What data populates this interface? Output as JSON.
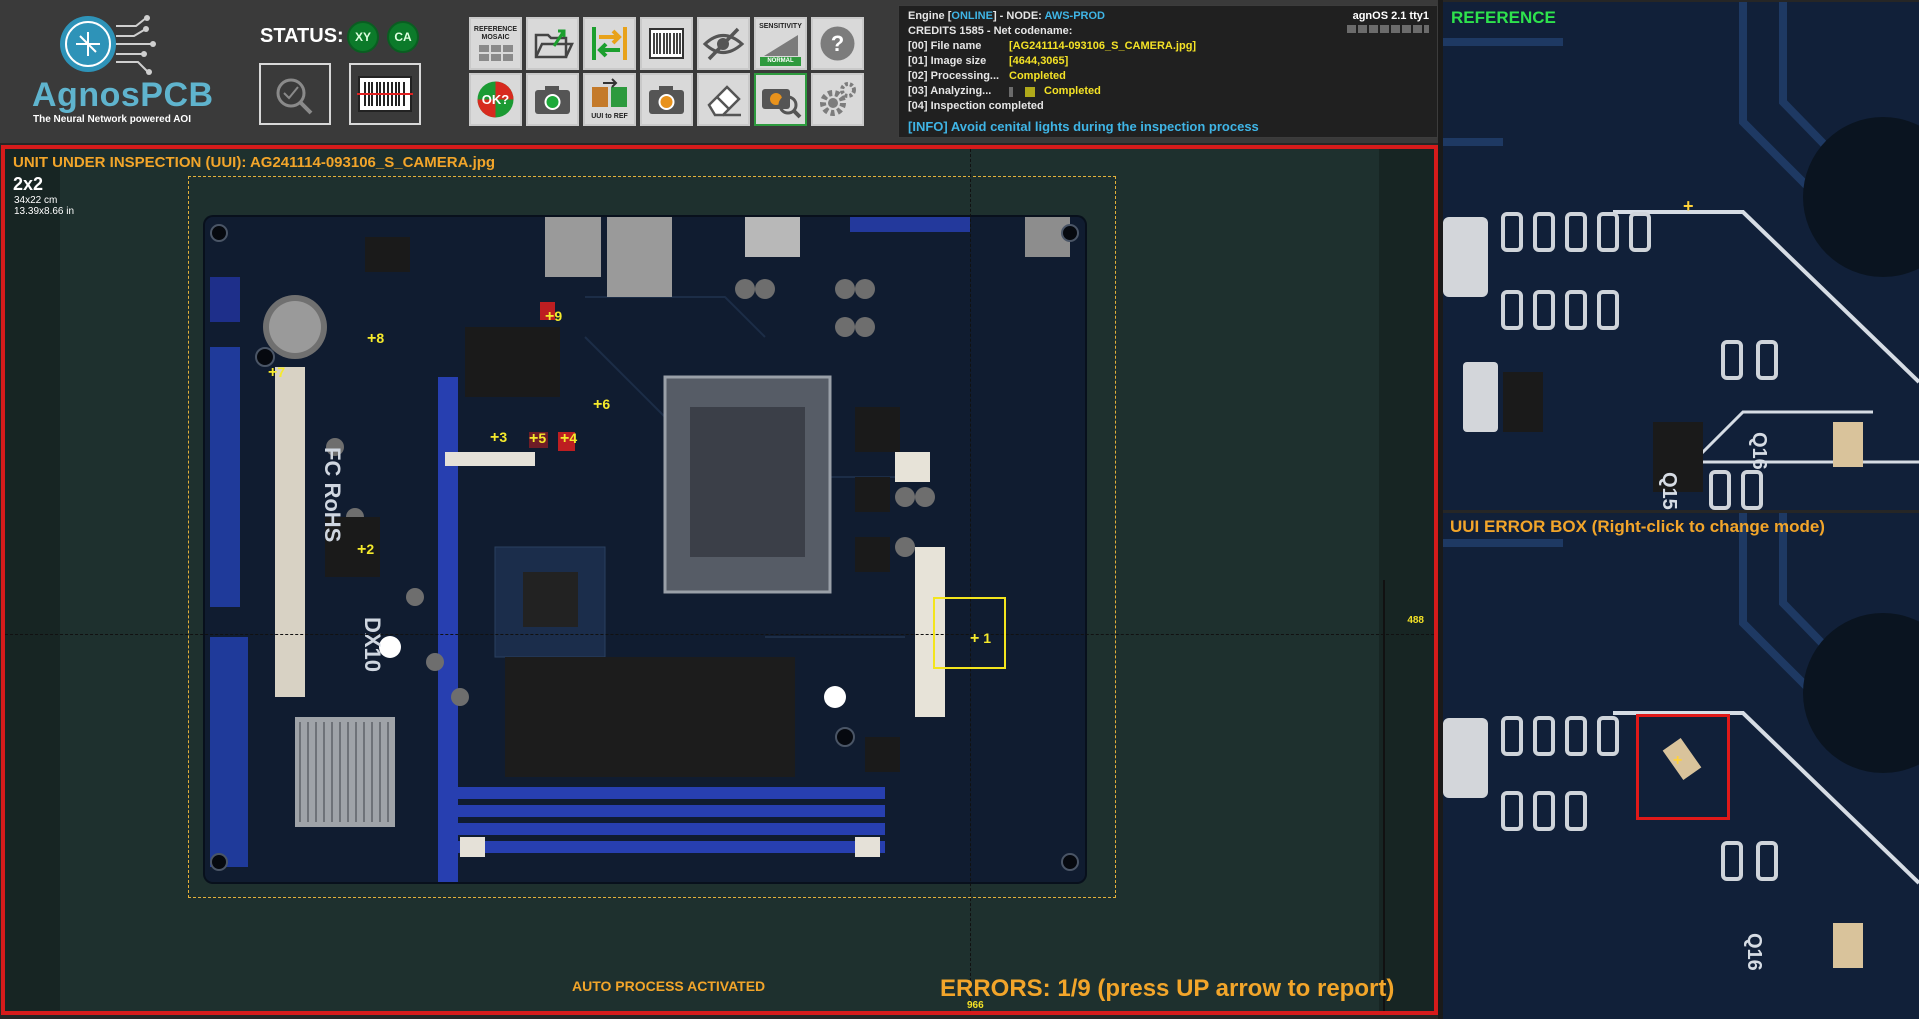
{
  "app": {
    "name": "AgnosPCB",
    "tagline": "The Neural Network powered AOI"
  },
  "status": {
    "label": "STATUS:",
    "indicators": [
      "XY",
      "CA"
    ]
  },
  "toolbar": {
    "row1": [
      {
        "name": "reference-mosaic",
        "caption": "REFERENCE MOSAIC"
      },
      {
        "name": "open-folder",
        "caption": ""
      },
      {
        "name": "swap",
        "caption": ""
      },
      {
        "name": "barcode",
        "caption": ""
      },
      {
        "name": "hide",
        "caption": ""
      },
      {
        "name": "sensitivity",
        "caption": "SENSITIVITY",
        "level": "NORMAL"
      },
      {
        "name": "help",
        "caption": ""
      }
    ],
    "row2": [
      {
        "name": "ok-check",
        "caption": "OK?"
      },
      {
        "name": "camera-green",
        "caption": ""
      },
      {
        "name": "uui-to-ref",
        "caption": "UUI to REF"
      },
      {
        "name": "camera-orange",
        "caption": ""
      },
      {
        "name": "eraser",
        "caption": ""
      },
      {
        "name": "camera-search",
        "caption": ""
      },
      {
        "name": "settings",
        "caption": ""
      }
    ]
  },
  "console": {
    "engine_prefix": "Engine [",
    "engine_state": "ONLINE",
    "engine_mid": "] - NODE: ",
    "node": "AWS-PROD",
    "credits": "CREDITS 1585 - Net codename:",
    "os": "agnOS 2.1 tty1",
    "lines": [
      {
        "label": "[00] File name",
        "value": "[AG241114-093106_S_CAMERA.jpg]"
      },
      {
        "label": "[01] Image size",
        "value": "[4644,3065]"
      },
      {
        "label": "[02] Processing...",
        "value": "Completed"
      },
      {
        "label": "[03] Analyzing...",
        "value": "Completed"
      },
      {
        "label": "[04] Inspection completed",
        "value": ""
      }
    ],
    "info": "[INFO] Avoid cenital lights during the inspection process"
  },
  "uui": {
    "title": "UNIT UNDER INSPECTION (UUI): AG241114-093106_S_CAMERA.jpg",
    "grid": "2x2",
    "size_cm": "34x22 cm",
    "size_in": "13.39x8.66 in",
    "coord_h": "488",
    "coord_v": "966",
    "auto_process": "AUTO PROCESS ACTIVATED",
    "errors": "ERRORS: 1/9 (press UP arrow to report)",
    "markers": [
      "1",
      "2",
      "3",
      "4",
      "5",
      "6",
      "7",
      "8",
      "9"
    ]
  },
  "reference": {
    "title": "REFERENCE"
  },
  "error_box": {
    "title": "UUI ERROR BOX (Right-click to change mode)"
  },
  "colors": {
    "accent": "#f2a52a",
    "error": "#d61b1b",
    "ok_green": "#0c7a2a",
    "info_blue": "#3fb5e6",
    "marker_yellow": "#f6ea2c"
  }
}
